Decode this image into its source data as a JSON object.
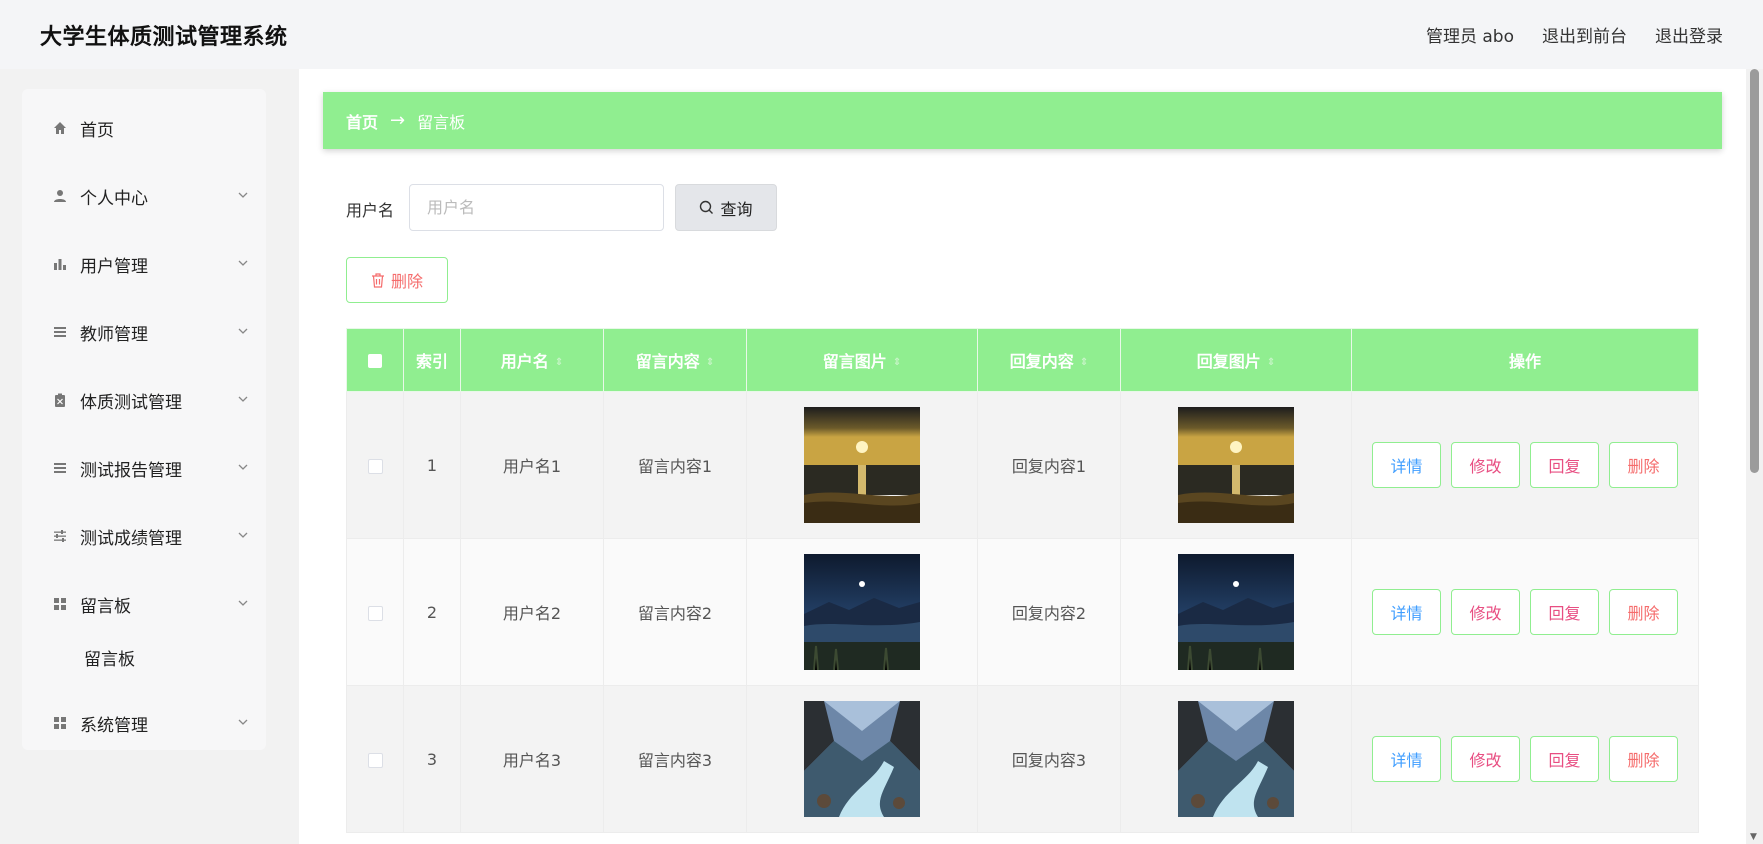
{
  "header": {
    "title": "大学生体质测试管理系统",
    "admin_label": "管理员 abo",
    "to_front": "退出到前台",
    "logout": "退出登录"
  },
  "sidebar": {
    "items": [
      {
        "label": "首页",
        "icon": "home-icon"
      },
      {
        "label": "个人中心",
        "icon": "user-icon"
      },
      {
        "label": "用户管理",
        "icon": "bar-chart-icon"
      },
      {
        "label": "教师管理",
        "icon": "list-icon"
      },
      {
        "label": "体质测试管理",
        "icon": "clipboard-icon"
      },
      {
        "label": "测试报告管理",
        "icon": "list-icon"
      },
      {
        "label": "测试成绩管理",
        "icon": "sliders-icon"
      },
      {
        "label": "留言板",
        "icon": "grid-icon"
      },
      {
        "label": "系统管理",
        "icon": "grid-icon"
      }
    ],
    "submenu": {
      "label": "留言板"
    }
  },
  "breadcrumb": {
    "home": "首页",
    "arrow": "→",
    "current": "留言板"
  },
  "search": {
    "label": "用户名",
    "placeholder": "用户名",
    "value": "",
    "button": "查询"
  },
  "toolbar": {
    "delete": "删除"
  },
  "table": {
    "headers": [
      "",
      "索引",
      "用户名",
      "留言内容",
      "留言图片",
      "回复内容",
      "回复图片",
      "操作"
    ],
    "sort_icon": "⇕",
    "rows": [
      {
        "index": "1",
        "username": "用户名1",
        "content": "留言内容1",
        "reply": "回复内容1",
        "image": "sunset-beach"
      },
      {
        "index": "2",
        "username": "用户名2",
        "content": "留言内容2",
        "reply": "回复内容2",
        "image": "night-mountains"
      },
      {
        "index": "3",
        "username": "用户名3",
        "content": "留言内容3",
        "reply": "回复内容3",
        "image": "mountain-river"
      }
    ],
    "actions": {
      "detail": "详情",
      "edit": "修改",
      "reply": "回复",
      "delete": "删除"
    }
  },
  "colors": {
    "accent": "#90ee90",
    "danger": "#f56c6c",
    "primary": "#409eff",
    "pink": "#e84e82"
  }
}
